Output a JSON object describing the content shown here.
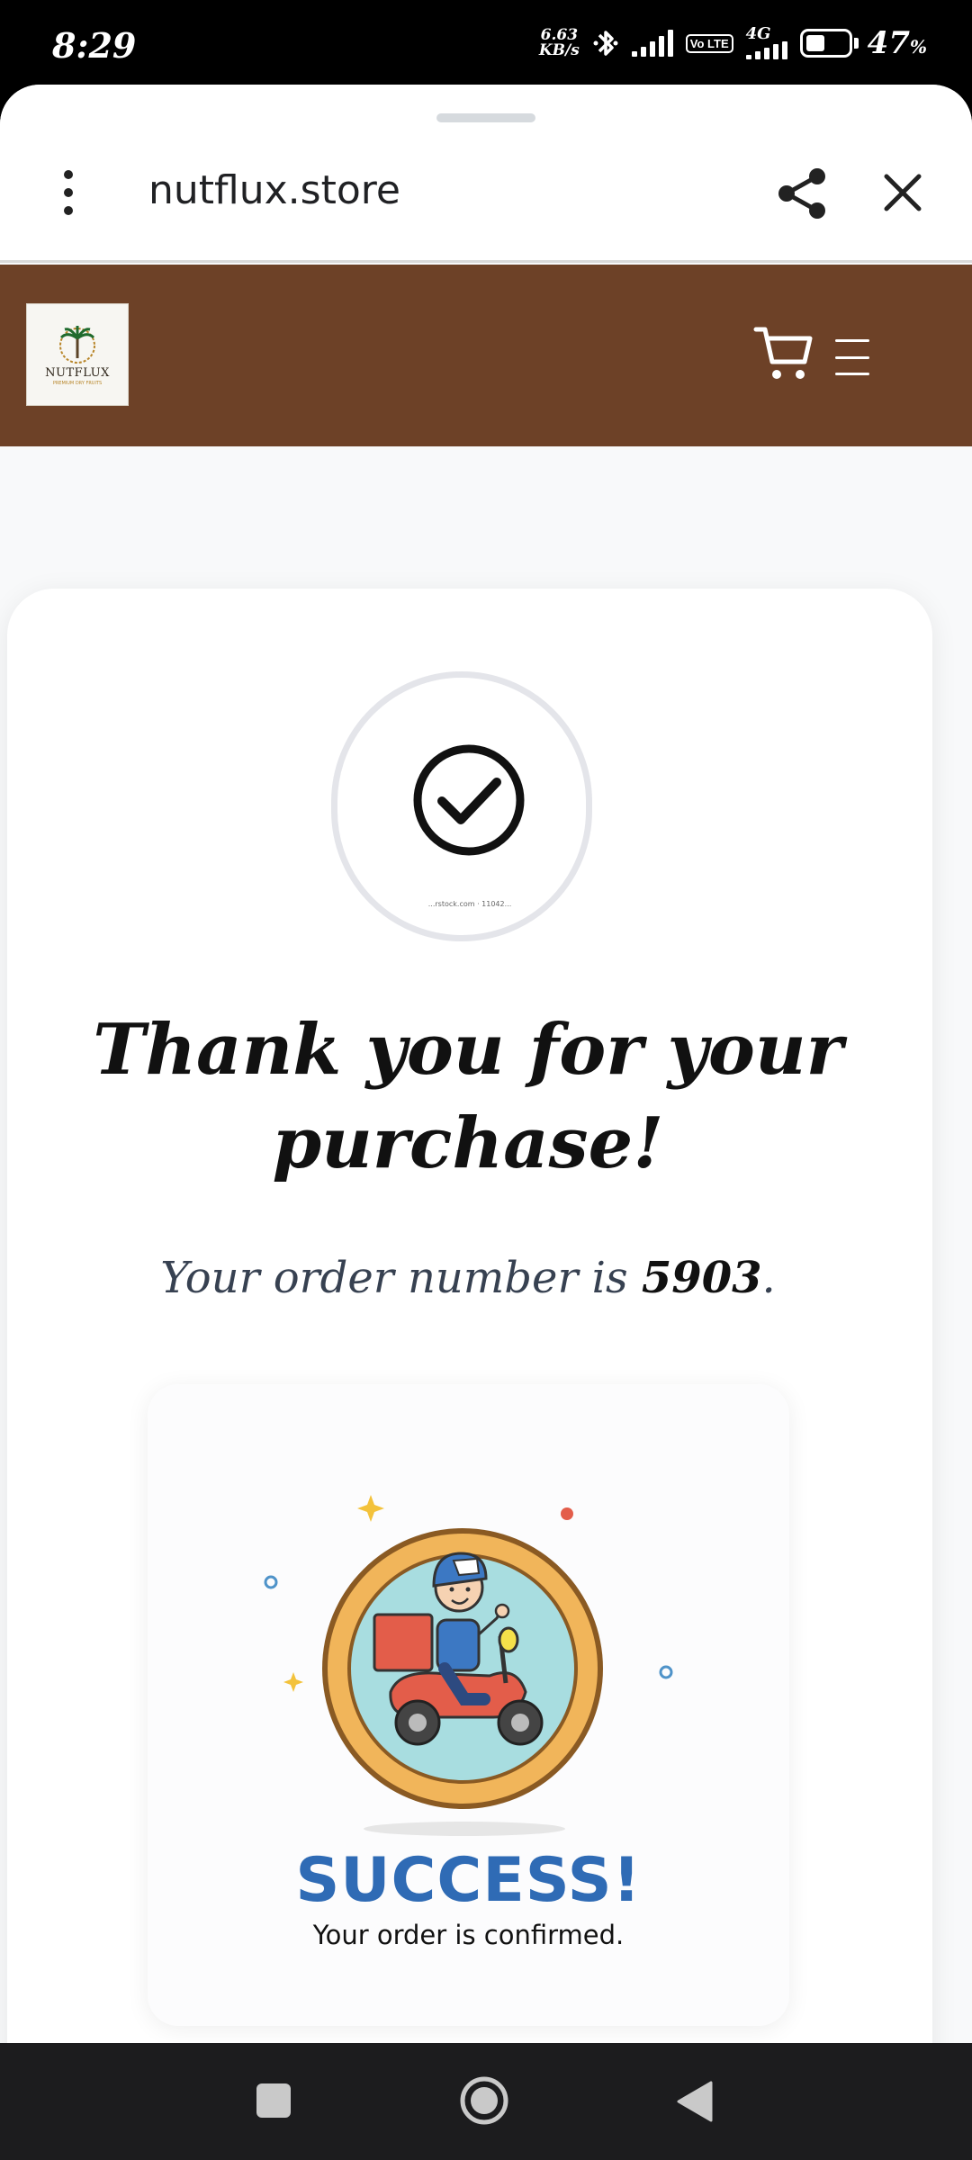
{
  "status_bar": {
    "time": "8:29",
    "net_speed_value": "6.63",
    "net_speed_unit": "KB/s",
    "volte": "Vo LTE",
    "network": "4G",
    "battery_percent": "47",
    "battery_unit": "%",
    "battery_level": 0.47
  },
  "browser": {
    "url": "nutflux.store",
    "icons": [
      "more-vert-icon",
      "share-icon",
      "close-icon"
    ]
  },
  "site_header": {
    "logo_text": "NUTFLUX",
    "logo_subtext": "PREMIUM DRY FRUITS",
    "colors": {
      "header_bg": "#6d4127"
    },
    "icons": [
      "cart-icon",
      "hamburger-icon"
    ]
  },
  "confirmation": {
    "image_watermark": "...rstock.com · 11042...",
    "title": "Thank you for your purchase!",
    "order_prefix": "Your order number is",
    "order_number": "5903",
    "order_suffix": "."
  },
  "success_card": {
    "title": "SUCCESS!",
    "subtitle": "Your order is confirmed.",
    "colors": {
      "title": "#2f6bb5"
    }
  },
  "nav_bar": {
    "icons": [
      "recents-square-icon",
      "home-circle-icon",
      "back-triangle-icon"
    ]
  }
}
